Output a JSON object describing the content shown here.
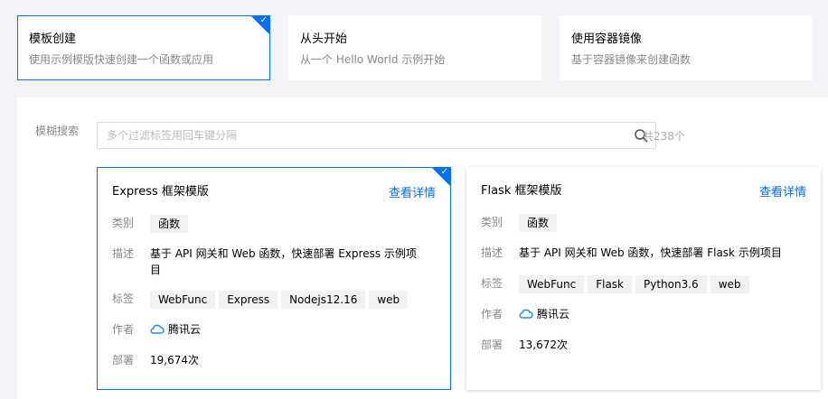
{
  "modes": [
    {
      "title": "模板创建",
      "desc": "使用示例模版快速创建一个函数或应用",
      "selected": true
    },
    {
      "title": "从头开始",
      "desc": "从一个 Hello World 示例开始",
      "selected": false
    },
    {
      "title": "使用容器镜像",
      "desc": "基于容器镜像来创建函数",
      "selected": false
    }
  ],
  "search": {
    "label": "模糊搜索",
    "placeholder": "多个过滤标签用回车键分隔",
    "count": "共238个"
  },
  "templates": [
    {
      "title": "Express 框架模版",
      "detail": "查看详情",
      "category_label": "类别",
      "category": "函数",
      "desc_label": "描述",
      "desc": "基于 API 网关和 Web 函数，快速部署 Express 示例项目",
      "tags_label": "标签",
      "tags": [
        "WebFunc",
        "Express",
        "Nodejs12.16",
        "web"
      ],
      "author_label": "作者",
      "author": "腾讯云",
      "deploy_label": "部署",
      "deploy": "19,674次"
    },
    {
      "title": "Flask 框架模版",
      "detail": "查看详情",
      "category_label": "类别",
      "category": "函数",
      "desc_label": "描述",
      "desc": "基于 API 网关和 Web 函数，快速部署 Flask 示例项目",
      "tags_label": "标签",
      "tags": [
        "WebFunc",
        "Flask",
        "Python3.6",
        "web"
      ],
      "author_label": "作者",
      "author": "腾讯云",
      "deploy_label": "部署",
      "deploy": "13,672次"
    }
  ],
  "colors": {
    "accent": "#006eff",
    "bg": "#f3f4f7"
  }
}
